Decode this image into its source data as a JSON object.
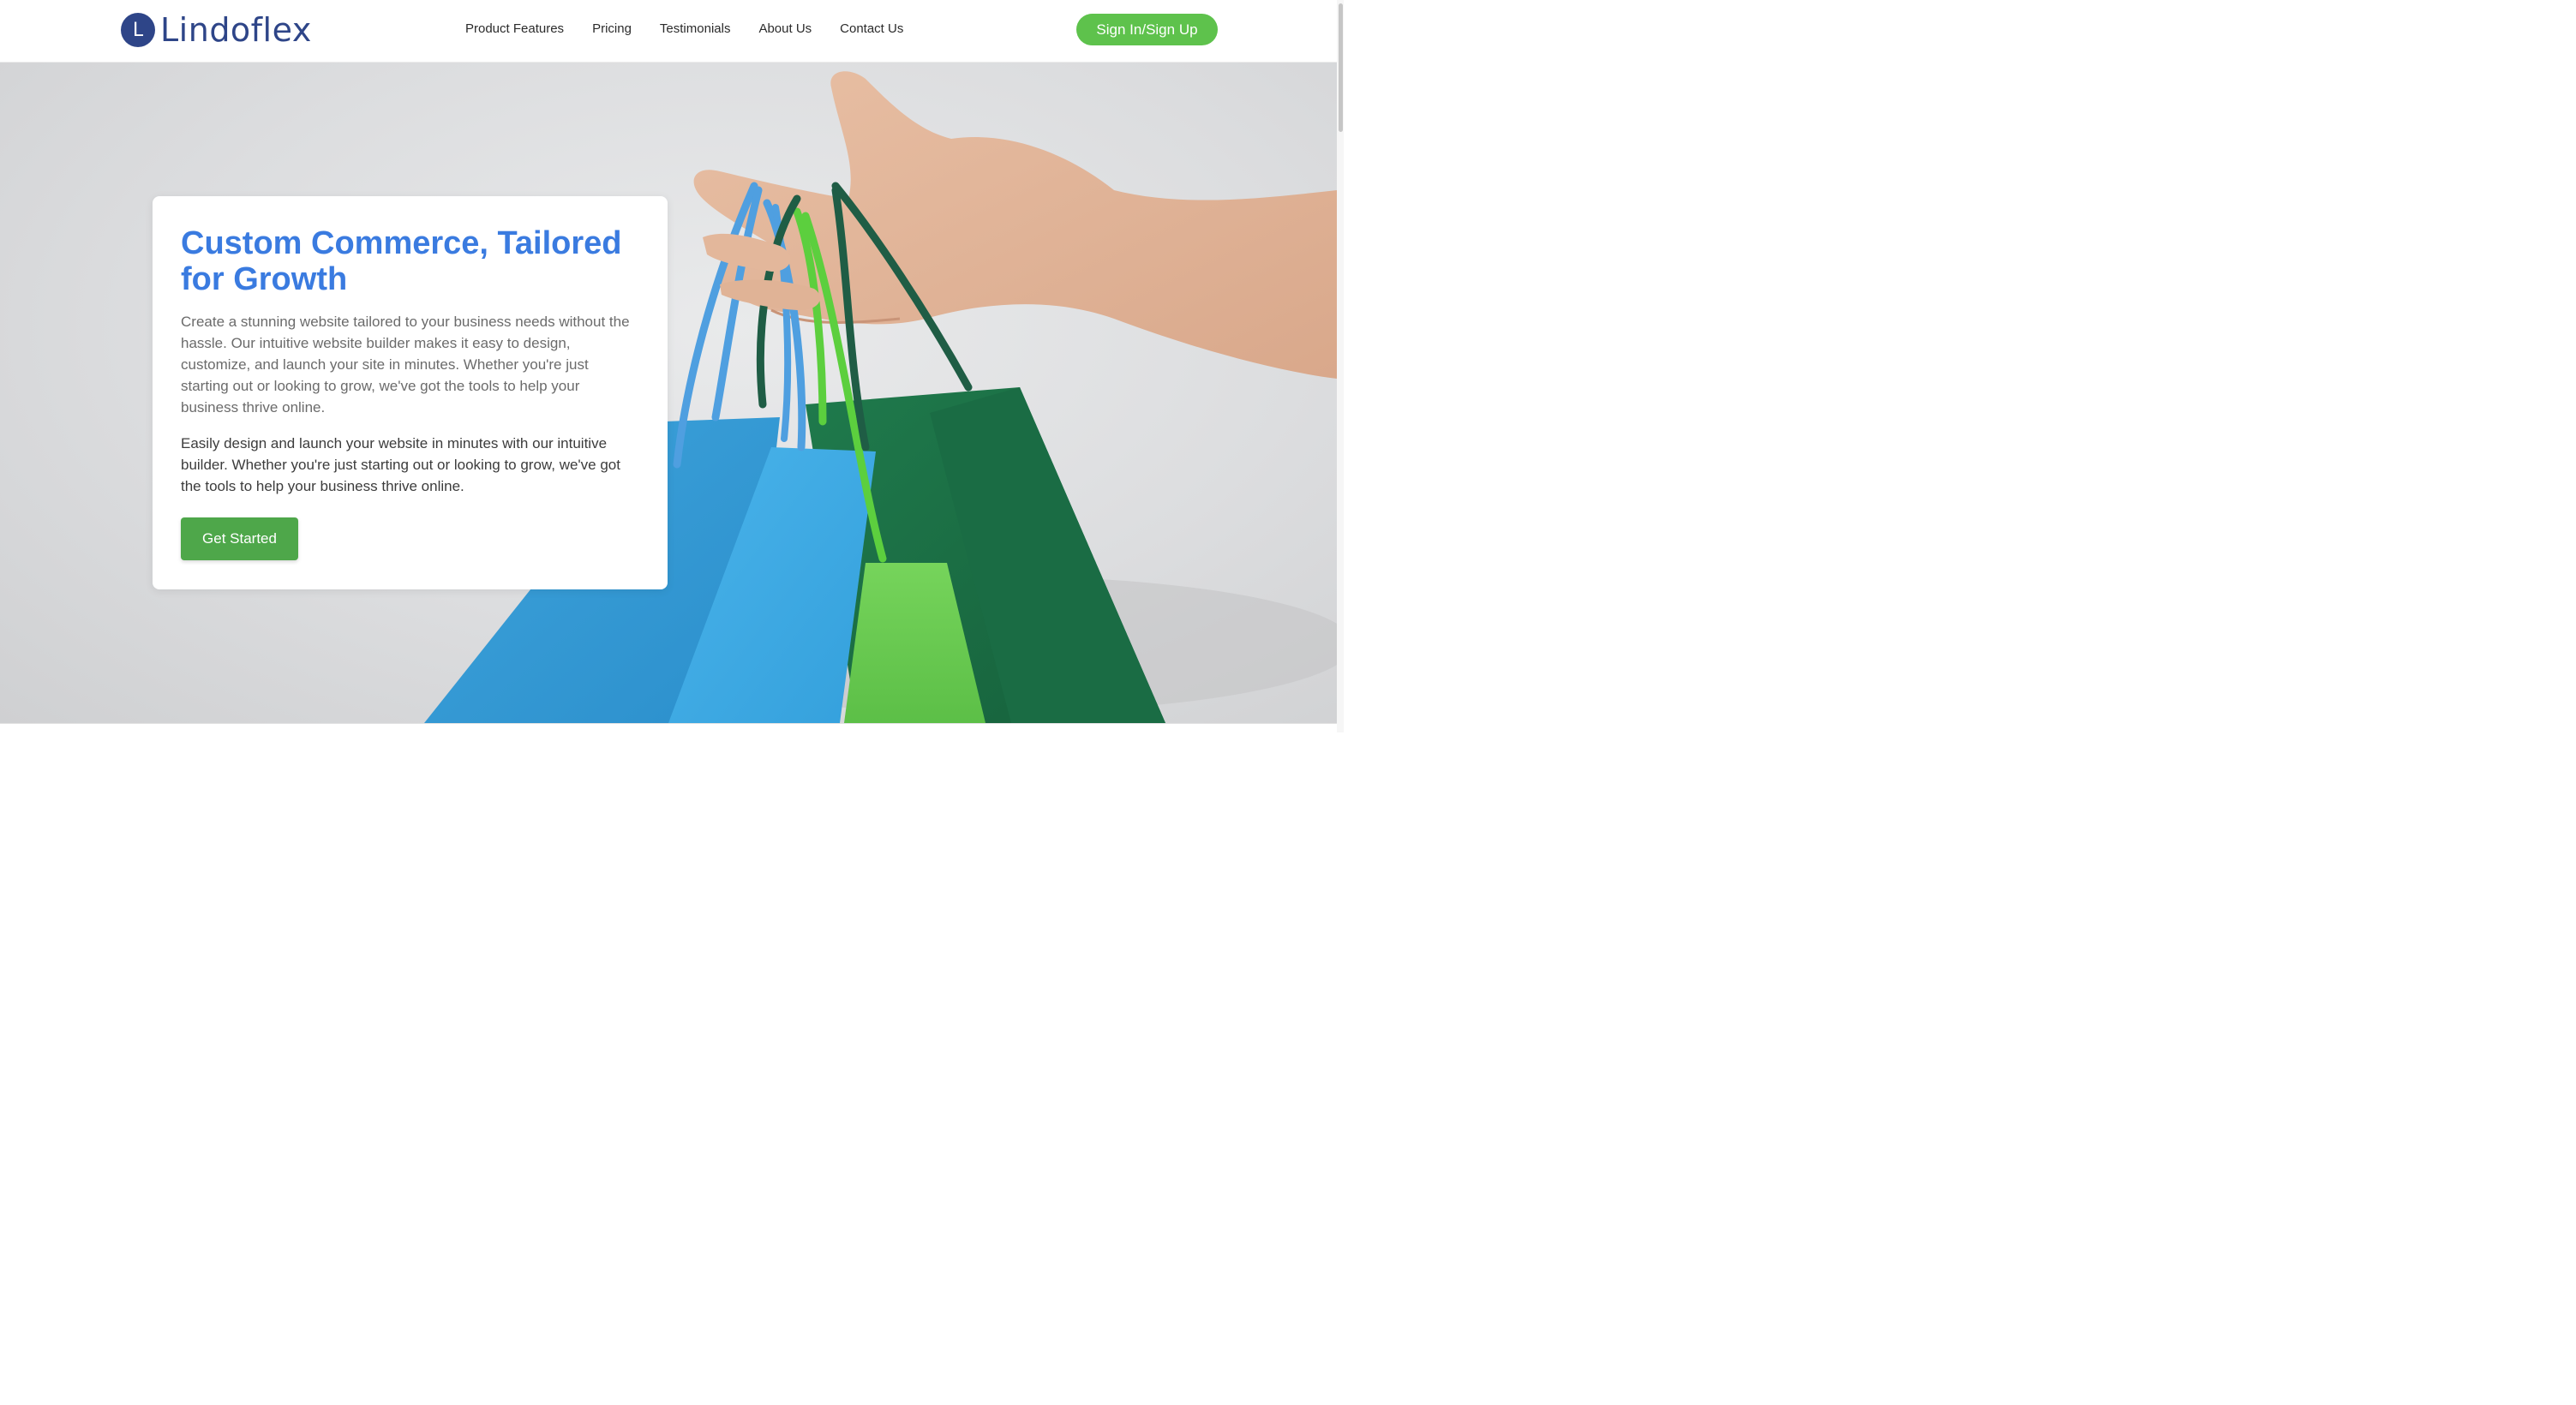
{
  "header": {
    "logo_letter": "L",
    "logo_text": "Lindoflex",
    "nav": [
      {
        "label": "Product Features"
      },
      {
        "label": "Pricing"
      },
      {
        "label": "Testimonials"
      },
      {
        "label": "About Us"
      },
      {
        "label": "Contact Us"
      }
    ],
    "signin_label": "Sign In/Sign Up"
  },
  "hero": {
    "title": "Custom Commerce, Tailored for Growth",
    "paragraph1": "Create a stunning website tailored to your business needs without the hassle. Our intuitive website builder makes it easy to design, customize, and launch your site in minutes. Whether you're just starting out or looking to grow, we've got the tools to help your business thrive online.",
    "paragraph2": "Easily design and launch your website in minutes with our intuitive builder. Whether you're just starting out or looking to grow, we've got the tools to help your business thrive online.",
    "cta_label": "Get Started"
  },
  "colors": {
    "brand_navy": "#2e4588",
    "accent_blue": "#3a7be0",
    "cta_green": "#4ea74a",
    "signin_green": "#5ec24c"
  }
}
